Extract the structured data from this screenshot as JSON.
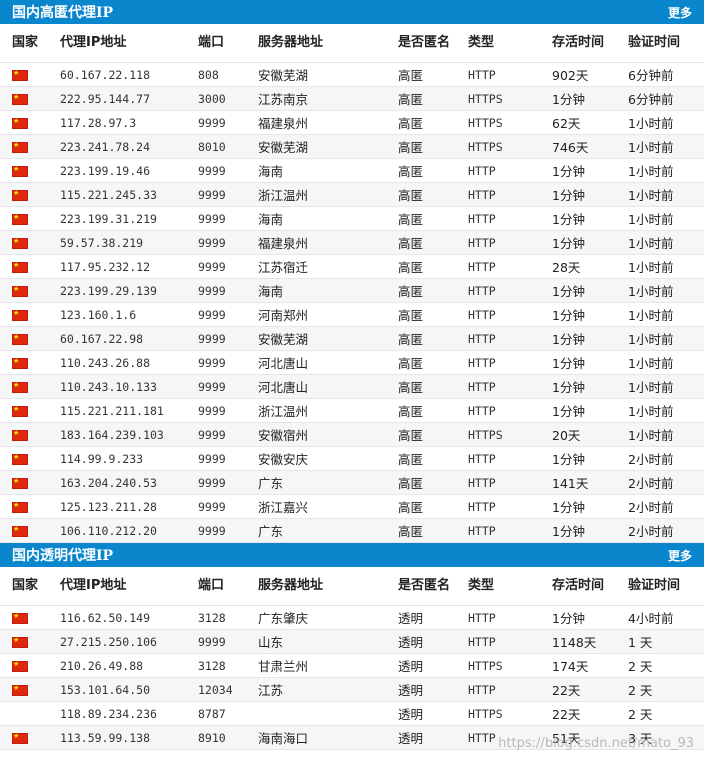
{
  "sections": [
    {
      "title": "国内高匿代理IP",
      "more": "更多",
      "columns": [
        "国家",
        "代理IP地址",
        "端口",
        "服务器地址",
        "是否匿名",
        "类型",
        "存活时间",
        "验证时间"
      ],
      "rows": [
        {
          "ip": "60.167.22.118",
          "port": "808",
          "server": "安徽芜湖",
          "anon": "高匿",
          "type": "HTTP",
          "alive": "902天",
          "verify": "6分钟前",
          "flag": "cn-flag-icon"
        },
        {
          "ip": "222.95.144.77",
          "port": "3000",
          "server": "江苏南京",
          "anon": "高匿",
          "type": "HTTPS",
          "alive": "1分钟",
          "verify": "6分钟前",
          "flag": "cn-flag-icon"
        },
        {
          "ip": "117.28.97.3",
          "port": "9999",
          "server": "福建泉州",
          "anon": "高匿",
          "type": "HTTPS",
          "alive": "62天",
          "verify": "1小时前",
          "flag": "cn-flag-icon"
        },
        {
          "ip": "223.241.78.24",
          "port": "8010",
          "server": "安徽芜湖",
          "anon": "高匿",
          "type": "HTTPS",
          "alive": "746天",
          "verify": "1小时前",
          "flag": "cn-flag-icon"
        },
        {
          "ip": "223.199.19.46",
          "port": "9999",
          "server": "海南",
          "anon": "高匿",
          "type": "HTTP",
          "alive": "1分钟",
          "verify": "1小时前",
          "flag": "cn-flag-icon"
        },
        {
          "ip": "115.221.245.33",
          "port": "9999",
          "server": "浙江温州",
          "anon": "高匿",
          "type": "HTTP",
          "alive": "1分钟",
          "verify": "1小时前",
          "flag": "cn-flag-icon"
        },
        {
          "ip": "223.199.31.219",
          "port": "9999",
          "server": "海南",
          "anon": "高匿",
          "type": "HTTP",
          "alive": "1分钟",
          "verify": "1小时前",
          "flag": "cn-flag-icon"
        },
        {
          "ip": "59.57.38.219",
          "port": "9999",
          "server": "福建泉州",
          "anon": "高匿",
          "type": "HTTP",
          "alive": "1分钟",
          "verify": "1小时前",
          "flag": "cn-flag-icon"
        },
        {
          "ip": "117.95.232.12",
          "port": "9999",
          "server": "江苏宿迁",
          "anon": "高匿",
          "type": "HTTP",
          "alive": "28天",
          "verify": "1小时前",
          "flag": "cn-flag-icon"
        },
        {
          "ip": "223.199.29.139",
          "port": "9999",
          "server": "海南",
          "anon": "高匿",
          "type": "HTTP",
          "alive": "1分钟",
          "verify": "1小时前",
          "flag": "cn-flag-icon"
        },
        {
          "ip": "123.160.1.6",
          "port": "9999",
          "server": "河南郑州",
          "anon": "高匿",
          "type": "HTTP",
          "alive": "1分钟",
          "verify": "1小时前",
          "flag": "cn-flag-icon"
        },
        {
          "ip": "60.167.22.98",
          "port": "9999",
          "server": "安徽芜湖",
          "anon": "高匿",
          "type": "HTTP",
          "alive": "1分钟",
          "verify": "1小时前",
          "flag": "cn-flag-icon"
        },
        {
          "ip": "110.243.26.88",
          "port": "9999",
          "server": "河北唐山",
          "anon": "高匿",
          "type": "HTTP",
          "alive": "1分钟",
          "verify": "1小时前",
          "flag": "cn-flag-icon"
        },
        {
          "ip": "110.243.10.133",
          "port": "9999",
          "server": "河北唐山",
          "anon": "高匿",
          "type": "HTTP",
          "alive": "1分钟",
          "verify": "1小时前",
          "flag": "cn-flag-icon"
        },
        {
          "ip": "115.221.211.181",
          "port": "9999",
          "server": "浙江温州",
          "anon": "高匿",
          "type": "HTTP",
          "alive": "1分钟",
          "verify": "1小时前",
          "flag": "cn-flag-icon"
        },
        {
          "ip": "183.164.239.103",
          "port": "9999",
          "server": "安徽宿州",
          "anon": "高匿",
          "type": "HTTPS",
          "alive": "20天",
          "verify": "1小时前",
          "flag": "cn-flag-icon"
        },
        {
          "ip": "114.99.9.233",
          "port": "9999",
          "server": "安徽安庆",
          "anon": "高匿",
          "type": "HTTP",
          "alive": "1分钟",
          "verify": "2小时前",
          "flag": "cn-flag-icon"
        },
        {
          "ip": "163.204.240.53",
          "port": "9999",
          "server": "广东",
          "anon": "高匿",
          "type": "HTTP",
          "alive": "141天",
          "verify": "2小时前",
          "flag": "cn-flag-icon"
        },
        {
          "ip": "125.123.211.28",
          "port": "9999",
          "server": "浙江嘉兴",
          "anon": "高匿",
          "type": "HTTP",
          "alive": "1分钟",
          "verify": "2小时前",
          "flag": "cn-flag-icon"
        },
        {
          "ip": "106.110.212.20",
          "port": "9999",
          "server": "广东",
          "anon": "高匿",
          "type": "HTTP",
          "alive": "1分钟",
          "verify": "2小时前",
          "flag": "cn-flag-icon"
        }
      ]
    },
    {
      "title": "国内透明代理IP",
      "more": "更多",
      "columns": [
        "国家",
        "代理IP地址",
        "端口",
        "服务器地址",
        "是否匿名",
        "类型",
        "存活时间",
        "验证时间"
      ],
      "rows": [
        {
          "ip": "116.62.50.149",
          "port": "3128",
          "server": "广东肇庆",
          "anon": "透明",
          "type": "HTTP",
          "alive": "1分钟",
          "verify": "4小时前",
          "flag": "cn-flag-icon"
        },
        {
          "ip": "27.215.250.106",
          "port": "9999",
          "server": "山东",
          "anon": "透明",
          "type": "HTTP",
          "alive": "1148天",
          "verify": "1 天",
          "flag": "cn-flag-icon"
        },
        {
          "ip": "210.26.49.88",
          "port": "3128",
          "server": "甘肃兰州",
          "anon": "透明",
          "type": "HTTPS",
          "alive": "174天",
          "verify": "2 天",
          "flag": "cn-flag-icon"
        },
        {
          "ip": "153.101.64.50",
          "port": "12034",
          "server": "江苏",
          "anon": "透明",
          "type": "HTTP",
          "alive": "22天",
          "verify": "2 天",
          "flag": "cn-flag-icon"
        },
        {
          "ip": "118.89.234.236",
          "port": "8787",
          "server": "",
          "anon": "透明",
          "type": "HTTPS",
          "alive": "22天",
          "verify": "2 天",
          "flag": ""
        },
        {
          "ip": "113.59.99.138",
          "port": "8910",
          "server": "海南海口",
          "anon": "透明",
          "type": "HTTP",
          "alive": "51天",
          "verify": "3 天",
          "flag": "cn-flag-icon"
        }
      ]
    }
  ],
  "watermark": "https://blog.csdn.net/mato_93"
}
